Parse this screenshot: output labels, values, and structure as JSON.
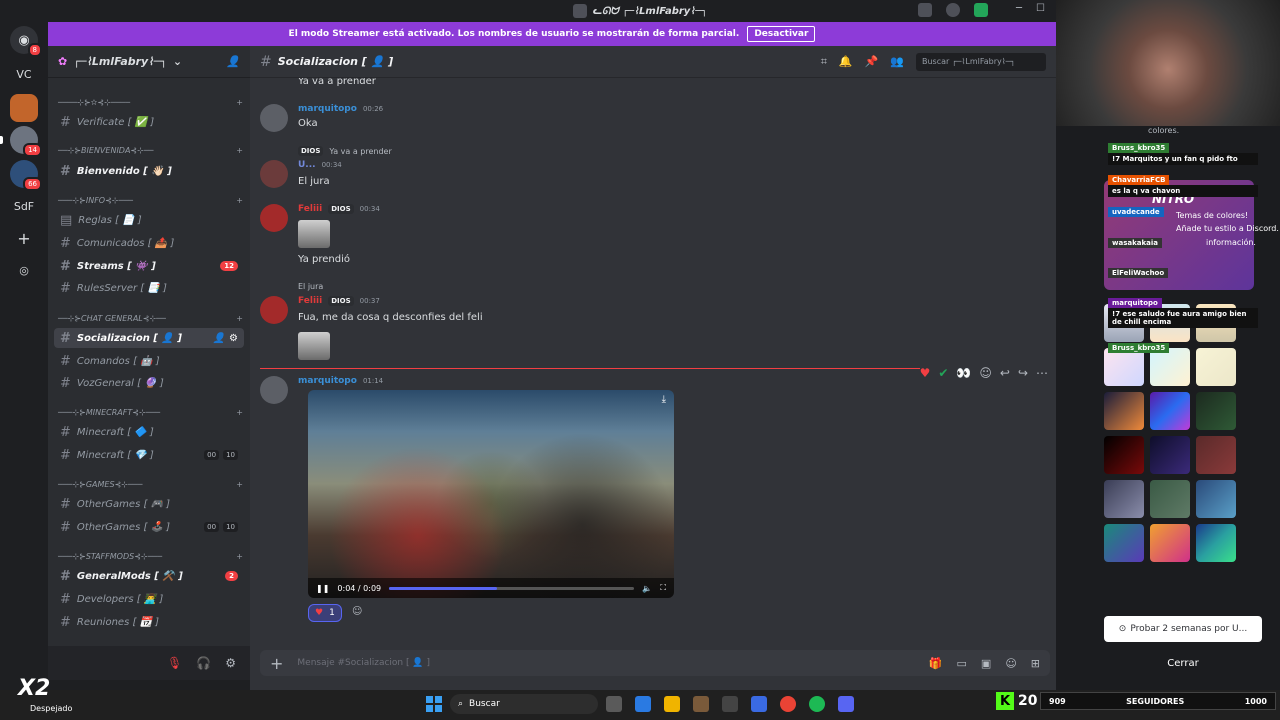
{
  "window": {
    "title": "ᓚᘏᗢ ┌─⌇LmlFabry⌇─┐"
  },
  "banner": {
    "text": "El modo Streamer está activado. Los nombres de usuario se mostrarán de forma parcial.",
    "button": "Desactivar",
    "color": "#8d3bd8"
  },
  "servers": [
    {
      "label": "VC",
      "badge": ""
    },
    {
      "label": "",
      "badge": ""
    },
    {
      "label": "",
      "badge": "14"
    },
    {
      "label": "",
      "badge": "66"
    },
    {
      "label": "SdF",
      "badge": ""
    }
  ],
  "discord_badge": "8",
  "guild": {
    "name": "┌─⌇LmlFabry⌇─┐"
  },
  "channels": {
    "cat_verify": "────⊹⊱✫⊰⊹────",
    "verificate": "Verificate  [ ✅ ]",
    "cat_bienvenida": "──⊹⊱BIENVENIDA⊰⊹──",
    "bienvenido": "Bienvenido  [ 👋🏻 ]",
    "cat_info": "───⊹⊱INFO⊰⊹───",
    "reglas": "Reglas  [ 📄 ]",
    "comunicados": "Comunicados  [ 📤 ]",
    "streams": "Streams  [ 👾 ]",
    "streams_badge": "12",
    "rulesserver": "RulesServer  [ 📑 ]",
    "cat_chat": "──⊹⊱CHAT GENERAL⊰⊹──",
    "socializacion": "Socializacion  [ 👤 ]",
    "comandos": "Comandos  [ 🤖 ]",
    "vozgeneral": "VozGeneral  [ 🔮 ]",
    "cat_minecraft": "───⊹⊱MINECRAFT⊰⊹───",
    "minecraft1": "Minecraft  [ 🔷 ]",
    "minecraft2": "Minecraft  [ 💎 ]",
    "minecraft2_a": "00",
    "minecraft2_b": "10",
    "cat_games": "───⊹⊱GAMES⊰⊹───",
    "othergames1": "OtherGames  [ 🎮 ]",
    "othergames2": "OtherGames  [ 🕹️ ]",
    "othergames2_a": "00",
    "othergames2_b": "10",
    "cat_staff": "───⊹⊱STAFFMODS⊰⊹───",
    "generalmods": "GeneralMods  [ ⚒️ ]",
    "generalmods_badge": "2",
    "developers": "Developers  [ 👨‍💻 ]",
    "reuniones": "Reuniones  [ 📆 ]"
  },
  "chat": {
    "channel": "Socializacion  [ 👤 ]",
    "search_placeholder": "Buscar ┌─⌇LmlFabry⌇─┐",
    "composer_placeholder": "Mensaje #Socializacion  [ 👤 ]"
  },
  "messages": {
    "top_text": "Ya va a prender",
    "m1": {
      "user": "marquitopo",
      "time": "00:26",
      "text": "Oka"
    },
    "m2": {
      "reply_role": "DIOS",
      "reply_text": "Ya va a prender",
      "user": "U...",
      "time": "00:34",
      "text": "El jura"
    },
    "m3": {
      "user": "Feliii",
      "role": "DIOS",
      "time": "00:34",
      "text": "Ya prendió"
    },
    "m4": {
      "reply_text": "El jura",
      "user": "Feliii",
      "role": "DIOS",
      "time": "00:37",
      "text": "Fua, me da cosa q desconfies del feli"
    },
    "m5": {
      "user": "marquitopo",
      "time": "01:14",
      "video_time": "0:04 / 0:09",
      "video_progress": 0.44,
      "reaction_count": "1"
    }
  },
  "overlay": {
    "colores": "colores.",
    "nitro": "NITRO",
    "nitro_line1": "Temas de colores!",
    "nitro_line2": "Añade tu estilo a Discord.",
    "nitro_line3": "información.",
    "chat": [
      {
        "user": "Bruss_kbro35",
        "text": "!7 Marquitos y un fan q pido fto"
      },
      {
        "user": "ChavarriaFCB",
        "text": "es la q va chavon"
      },
      {
        "user": "uvadecande",
        "text": ""
      },
      {
        "user": "wasakakaia",
        "text": ""
      },
      {
        "user": "ElFeliWachoo",
        "text": ""
      },
      {
        "user": "marquitopo",
        "text": "!7 ese saludo fue aura amigo bien de chill encima"
      },
      {
        "user": "Bruss_kbro35",
        "text": ""
      }
    ],
    "try_button": "Probar 2 semanas por U...",
    "close_button": "Cerrar"
  },
  "taskbar": {
    "weather": "Despejado",
    "x2": "X2",
    "search": "Buscar",
    "kick_count": "20",
    "followers_left": "909",
    "followers_label": "SEGUIDORES",
    "followers_right": "1000"
  }
}
